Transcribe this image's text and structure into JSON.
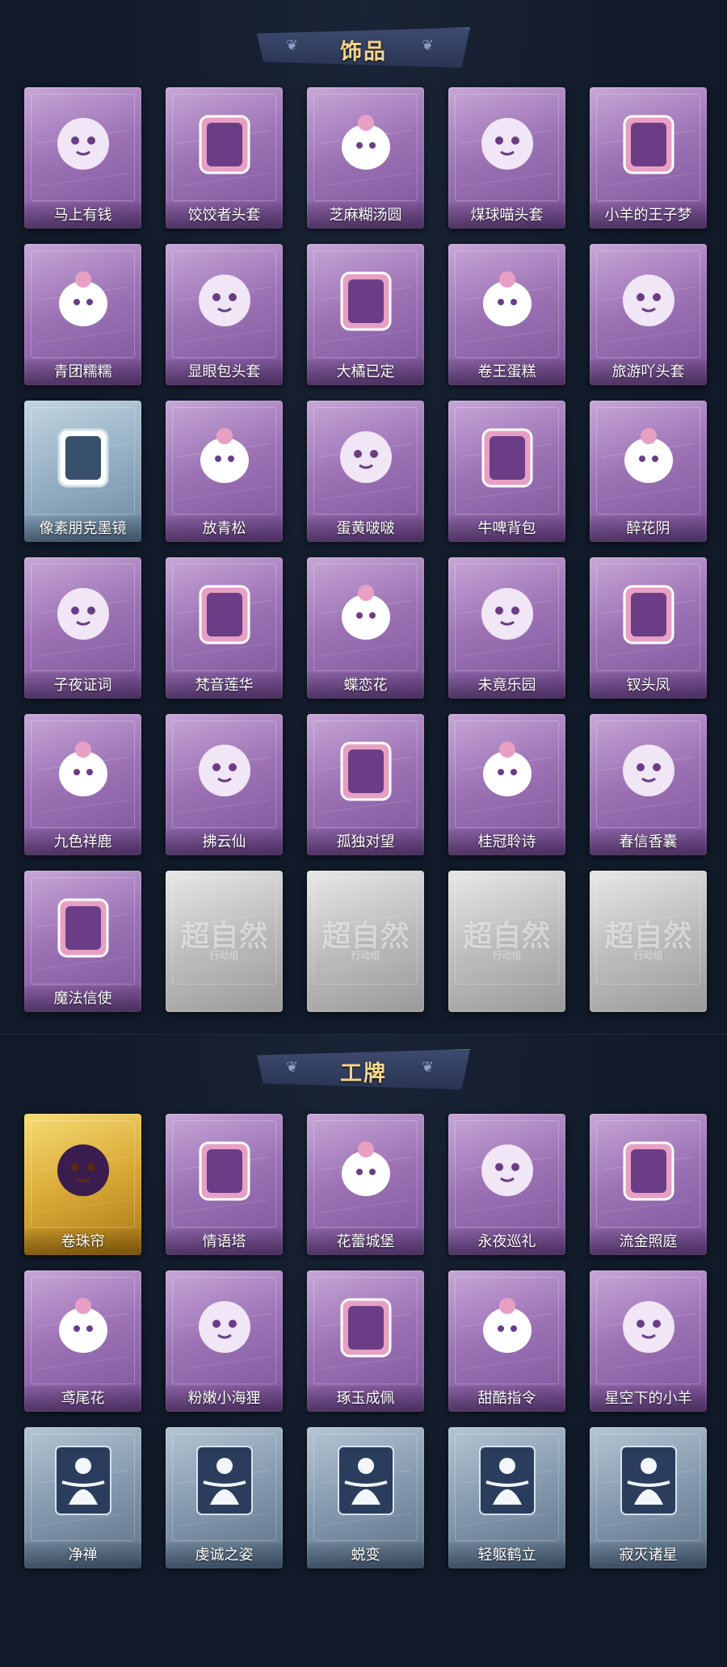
{
  "accessories": {
    "title": "饰品",
    "items": [
      {
        "name": "马上有钱",
        "rarity": "purple",
        "icon": "red-horse-head-icon"
      },
      {
        "name": "饺饺者头套",
        "rarity": "purple",
        "icon": "dumpling-cloud-head-icon"
      },
      {
        "name": "芝麻糊汤圆",
        "rarity": "purple",
        "icon": "rice-ball-head-icon"
      },
      {
        "name": "煤球喵头套",
        "rarity": "purple",
        "icon": "black-cat-head-icon"
      },
      {
        "name": "小羊的王子梦",
        "rarity": "purple",
        "icon": "sheep-crown-head-icon"
      },
      {
        "name": "青团糯糯",
        "rarity": "purple",
        "icon": "green-dumpling-head-icon"
      },
      {
        "name": "显眼包头套",
        "rarity": "purple",
        "icon": "bun-crown-head-icon"
      },
      {
        "name": "大橘已定",
        "rarity": "purple",
        "icon": "orange-slice-head-icon"
      },
      {
        "name": "卷王蛋糕",
        "rarity": "purple",
        "icon": "cake-roll-head-icon"
      },
      {
        "name": "旅游吖头套",
        "rarity": "purple",
        "icon": "duck-straw-hat-head-icon"
      },
      {
        "name": "像素朋克墨镜",
        "rarity": "blue",
        "icon": "pixel-sunglasses-icon"
      },
      {
        "name": "放青松",
        "rarity": "purple",
        "icon": "potted-pine-icon"
      },
      {
        "name": "蛋黄啵啵",
        "rarity": "purple",
        "icon": "yellow-chick-icon"
      },
      {
        "name": "牛啤背包",
        "rarity": "purple",
        "icon": "cow-beer-backpack-icon"
      },
      {
        "name": "醉花阴",
        "rarity": "purple",
        "icon": "flower-ornament-icon"
      },
      {
        "name": "子夜证词",
        "rarity": "purple",
        "icon": "black-owl-icon"
      },
      {
        "name": "梵音莲华",
        "rarity": "purple",
        "icon": "lotus-doll-icon"
      },
      {
        "name": "蝶恋花",
        "rarity": "purple",
        "icon": "butterfly-crescent-icon"
      },
      {
        "name": "未竟乐园",
        "rarity": "purple",
        "icon": "star-doll-icon"
      },
      {
        "name": "钗头凤",
        "rarity": "purple",
        "icon": "phoenix-crown-doll-icon"
      },
      {
        "name": "九色祥鹿",
        "rarity": "purple",
        "icon": "deer-pendant-icon"
      },
      {
        "name": "拂云仙",
        "rarity": "purple",
        "icon": "cloud-fairy-pendant-icon"
      },
      {
        "name": "孤独对望",
        "rarity": "purple",
        "icon": "silver-doll-pendant-icon"
      },
      {
        "name": "桂冠聆诗",
        "rarity": "purple",
        "icon": "laurel-doll-pendant-icon"
      },
      {
        "name": "春信香囊",
        "rarity": "purple",
        "icon": "sachet-pendant-icon"
      },
      {
        "name": "魔法信使",
        "rarity": "purple",
        "icon": "elephant-magician-icon"
      },
      {
        "name": "",
        "rarity": "grey",
        "icon": "placeholder-logo-icon",
        "watermark": "超自然",
        "watermark_sub": "行动组"
      },
      {
        "name": "",
        "rarity": "grey",
        "icon": "placeholder-logo-icon",
        "watermark": "超自然",
        "watermark_sub": "行动组"
      },
      {
        "name": "",
        "rarity": "grey",
        "icon": "placeholder-logo-icon",
        "watermark": "超自然",
        "watermark_sub": "行动组"
      },
      {
        "name": "",
        "rarity": "grey",
        "icon": "placeholder-logo-icon",
        "watermark": "超自然",
        "watermark_sub": "行动组"
      }
    ]
  },
  "badges": {
    "title": "工牌",
    "items": [
      {
        "name": "卷珠帘",
        "rarity": "gold",
        "icon": "curtain-card-icon"
      },
      {
        "name": "情语塔",
        "rarity": "purple",
        "icon": "tower-card-icon"
      },
      {
        "name": "花蕾城堡",
        "rarity": "purple",
        "icon": "castle-card-icon"
      },
      {
        "name": "永夜巡礼",
        "rarity": "purple",
        "icon": "night-moon-card-icon"
      },
      {
        "name": "流金照庭",
        "rarity": "purple",
        "icon": "golden-frame-card-icon"
      },
      {
        "name": "鸢尾花",
        "rarity": "purple",
        "icon": "iris-card-icon"
      },
      {
        "name": "粉嫩小海狸",
        "rarity": "purple",
        "icon": "beaver-card-icon"
      },
      {
        "name": "琢玉成佩",
        "rarity": "purple",
        "icon": "jade-card-icon"
      },
      {
        "name": "甜酷指令",
        "rarity": "purple",
        "icon": "shark-card-icon"
      },
      {
        "name": "星空下的小羊",
        "rarity": "purple",
        "icon": "sheep-starry-card-icon"
      },
      {
        "name": "净禅",
        "rarity": "steel",
        "icon": "meditation-silhouette-icon"
      },
      {
        "name": "虔诚之姿",
        "rarity": "steel",
        "icon": "prayer-silhouette-icon"
      },
      {
        "name": "蜕变",
        "rarity": "steel",
        "icon": "open-arms-silhouette-icon"
      },
      {
        "name": "轻躯鹤立",
        "rarity": "steel",
        "icon": "crane-pose-silhouette-icon"
      },
      {
        "name": "寂灭诸星",
        "rarity": "steel",
        "icon": "stars-silhouette-icon"
      }
    ]
  },
  "colors": {
    "background": "#111a28",
    "title_gold": "#f5d58a",
    "purple": "#9d73b6",
    "blue": "#94aec3",
    "gold": "#d9a936",
    "steel": "#8398ad",
    "grey": "#bdbdbd"
  }
}
